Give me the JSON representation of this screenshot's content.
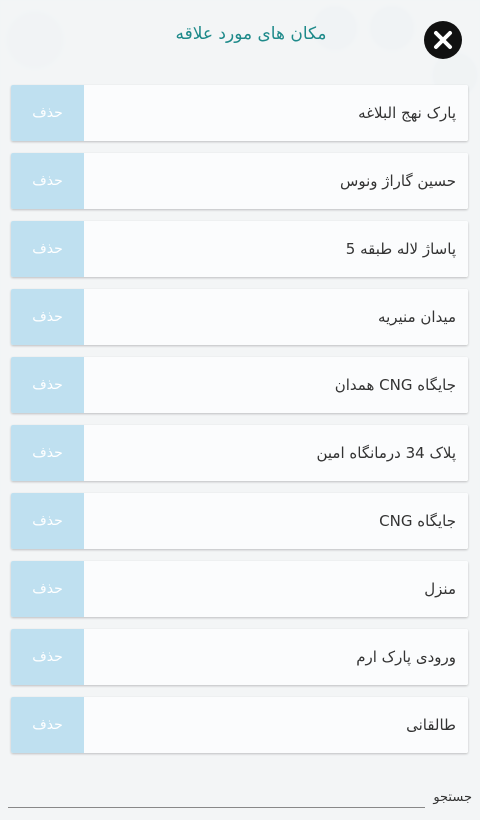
{
  "header": {
    "title": "مکان های مورد علاقه"
  },
  "favorites": [
    {
      "name": "پارک نهج البلاغه",
      "delete_label": "حذف"
    },
    {
      "name": "حسین گاراژ ونوس",
      "delete_label": "حذف"
    },
    {
      "name": "پاساژ لاله طبقه 5",
      "delete_label": "حذف"
    },
    {
      "name": "میدان منیریه",
      "delete_label": "حذف"
    },
    {
      "name": "جایگاه CNG همدان",
      "delete_label": "حذف"
    },
    {
      "name": "پلاک 34 درمانگاه امین",
      "delete_label": "حذف"
    },
    {
      "name": "جایگاه CNG",
      "delete_label": "حذف"
    },
    {
      "name": "منزل",
      "delete_label": "حذف"
    },
    {
      "name": "ورودی پارک ارم",
      "delete_label": "حذف"
    },
    {
      "name": "طالقانی",
      "delete_label": "حذف"
    }
  ],
  "search": {
    "label": "جستجو",
    "value": ""
  },
  "colors": {
    "title": "#1e8a8a",
    "delete_bg": "#bfe0f0",
    "close_bg": "#111111"
  }
}
